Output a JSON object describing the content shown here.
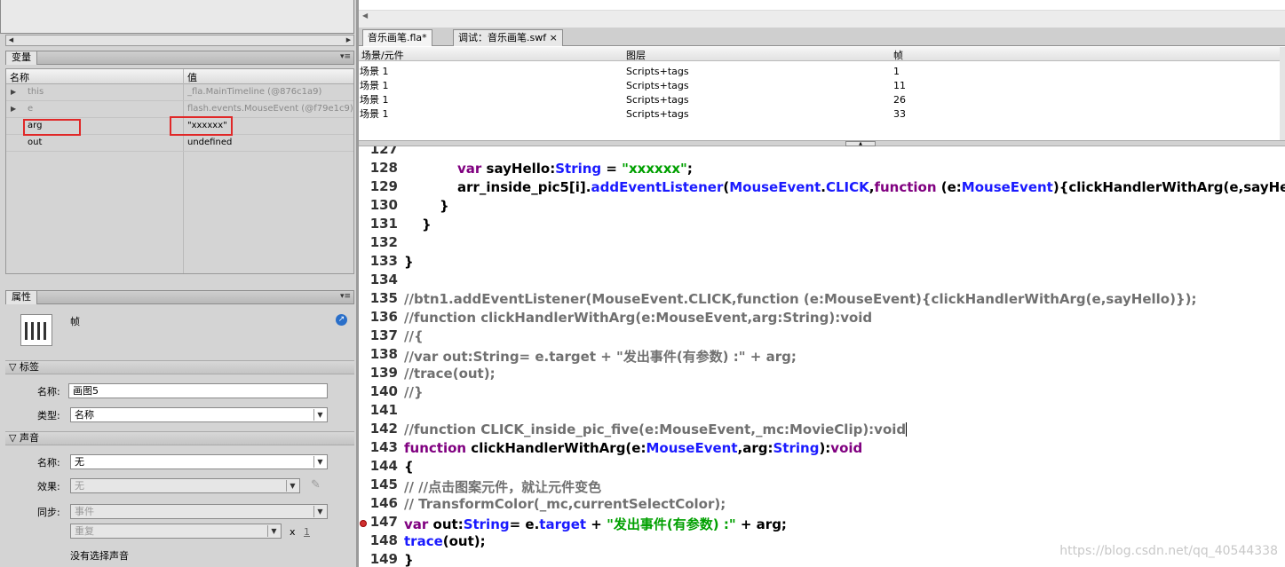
{
  "variables_panel": {
    "tab": "变量",
    "columns": [
      "名称",
      "值"
    ],
    "rows": [
      {
        "name": "this",
        "value": "_fla.MainTimeline (@876c1a9)",
        "expander": "▶",
        "dim": true
      },
      {
        "name": "e",
        "value": "flash.events.MouseEvent (@f79e1c9)",
        "expander": "▶",
        "dim": true
      },
      {
        "name": "arg",
        "value": "\"xxxxxx\"",
        "expander": "",
        "dim": false
      },
      {
        "name": "out",
        "value": "undefined",
        "expander": "",
        "dim": false
      }
    ]
  },
  "properties_panel": {
    "tab": "属性",
    "type_label": "帧",
    "label_section": "标签",
    "name_label": "名称:",
    "name_value": "画图5",
    "type_field_label": "类型:",
    "type_value": "名称",
    "sound_section": "声音",
    "sound_name_label": "名称:",
    "sound_name_value": "无",
    "effect_label": "效果:",
    "effect_value": "无",
    "sync_label": "同步:",
    "sync_value": "事件",
    "repeat_value": "重复",
    "repeat_x": "x",
    "repeat_count": "1",
    "no_sound": "没有选择声音"
  },
  "editor": {
    "tabs": [
      {
        "label": "音乐画笔.fla*",
        "active": true
      },
      {
        "label": "调试：音乐画笔.swf",
        "active": false
      }
    ],
    "close_glyph": "×",
    "breakpoint_table": {
      "columns": [
        "场景/元件",
        "图层",
        "帧"
      ],
      "rows": [
        [
          "场景 1",
          "Scripts+tags",
          "1"
        ],
        [
          "场景 1",
          "Scripts+tags",
          "11"
        ],
        [
          "场景 1",
          "Scripts+tags",
          "26"
        ],
        [
          "场景 1",
          "Scripts+tags",
          "33"
        ]
      ]
    },
    "line_numbers": [
      "127",
      "128",
      "129",
      "130",
      "131",
      "132",
      "133",
      "134",
      "135",
      "136",
      "137",
      "138",
      "139",
      "140",
      "141",
      "142",
      "143",
      "144",
      "145",
      "146",
      "147",
      "148",
      "149"
    ],
    "breakpoint_line": "147",
    "watermark": "https://blog.csdn.net/qq_40544338"
  }
}
